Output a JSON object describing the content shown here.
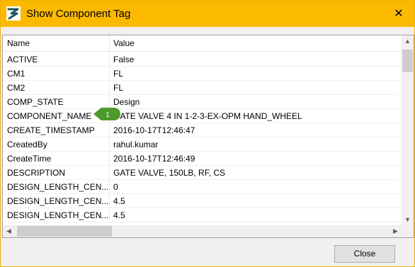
{
  "window": {
    "title": "Show Component Tag",
    "app_icon": "app-logo-icon",
    "close_glyph": "✕"
  },
  "grid": {
    "columns": [
      "Name",
      "Value"
    ],
    "rows": [
      {
        "name": "ACTIVE",
        "value": "False"
      },
      {
        "name": "CM1",
        "value": "FL"
      },
      {
        "name": "CM2",
        "value": "FL"
      },
      {
        "name": "COMP_STATE",
        "value": "Design"
      },
      {
        "name": "COMPONENT_NAME",
        "value": "GATE VALVE 4 IN 1-2-3-EX-OPM HAND_WHEEL"
      },
      {
        "name": "CREATE_TIMESTAMP",
        "value": "2016-10-17T12:46:47"
      },
      {
        "name": "CreatedBy",
        "value": "rahul.kumar"
      },
      {
        "name": "CreateTime",
        "value": "2016-10-17T12:46:49"
      },
      {
        "name": "DESCRIPTION",
        "value": "GATE VALVE, 150LB, RF, CS"
      },
      {
        "name": "DESIGN_LENGTH_CEN...",
        "value": "0"
      },
      {
        "name": "DESIGN_LENGTH_CEN...",
        "value": "4.5"
      },
      {
        "name": "DESIGN_LENGTH_CEN...",
        "value": "4.5"
      }
    ],
    "badge_label": "1",
    "badge_color": "#4e9a2a"
  },
  "footer": {
    "close_label": "Close"
  }
}
